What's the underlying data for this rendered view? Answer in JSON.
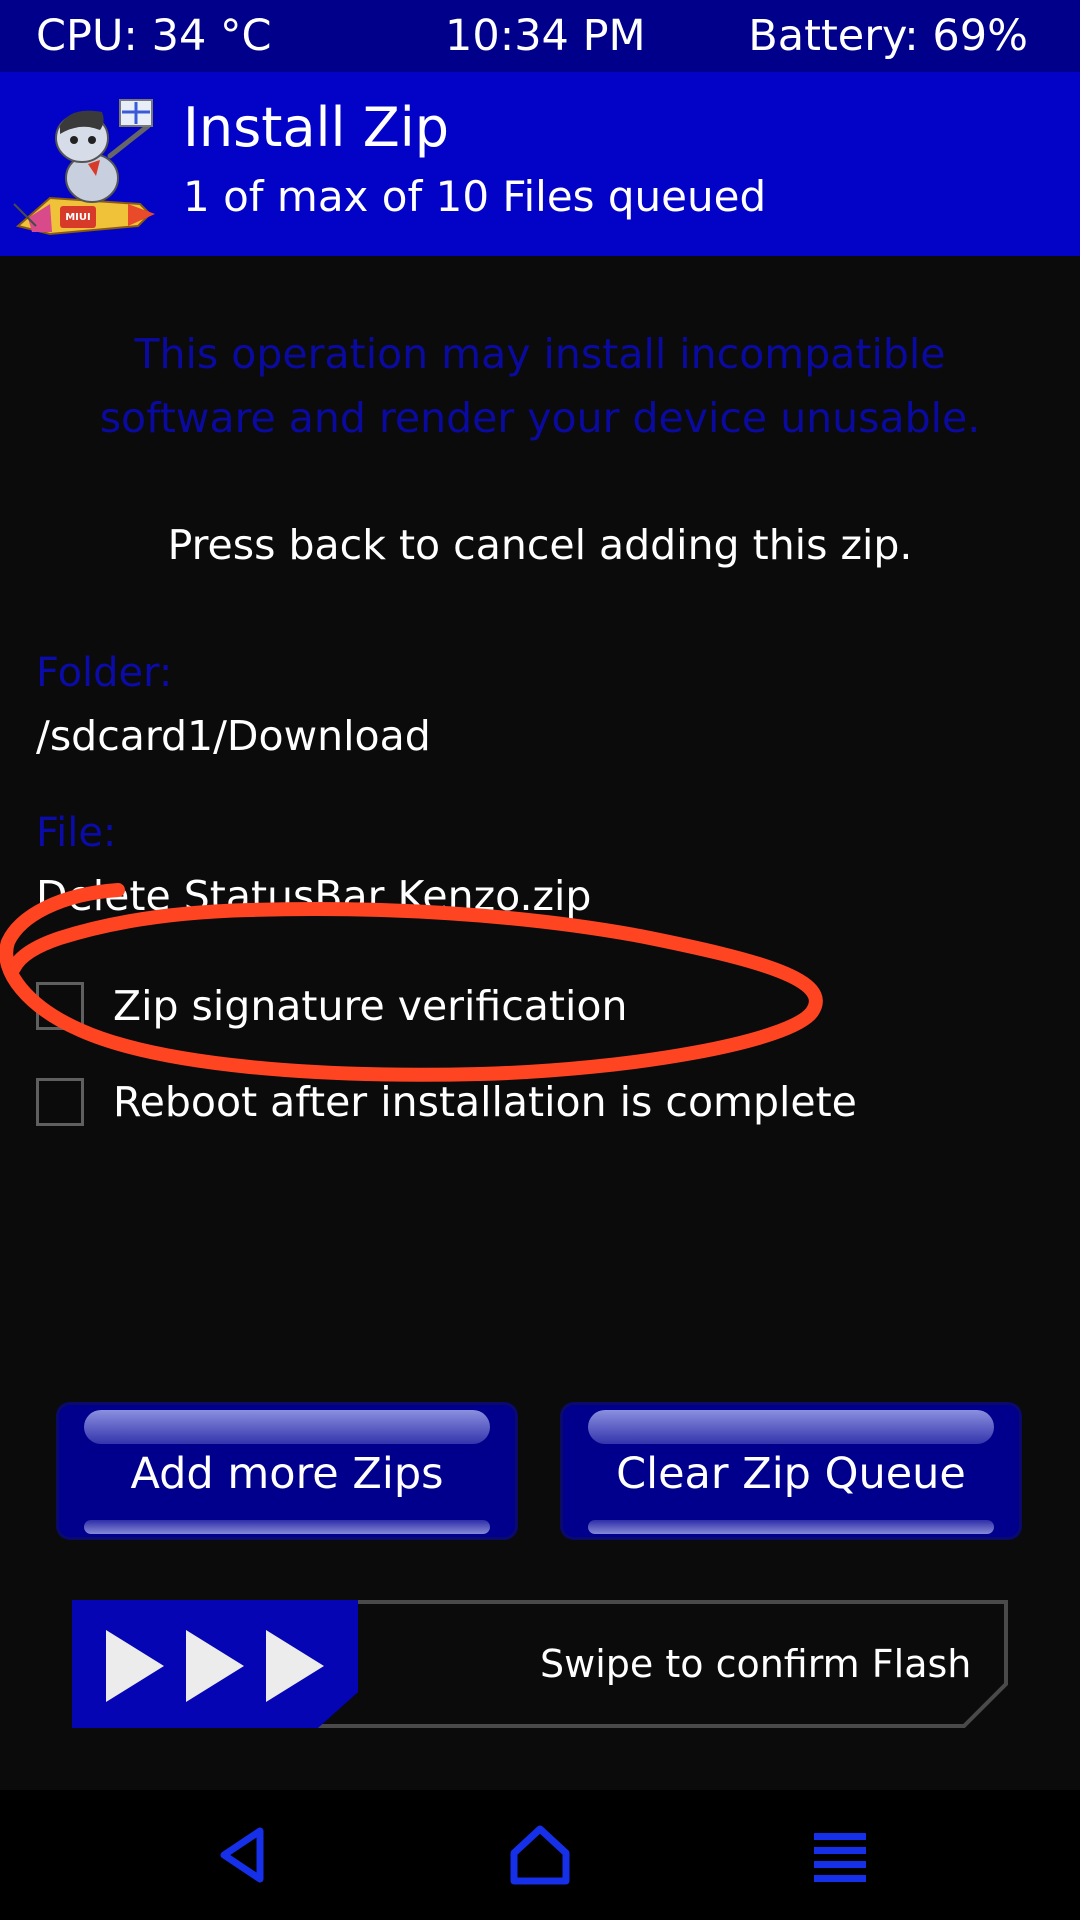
{
  "status_bar": {
    "cpu": "CPU: 34 °C",
    "time": "10:34 PM",
    "battery": "Battery: 69%"
  },
  "header": {
    "logo": "miui-rocket-logo",
    "title": "Install Zip",
    "subtitle": "1 of max of 10 Files queued"
  },
  "warning": {
    "line1": "This operation may install incompatible",
    "line2": "software and render your device unusable."
  },
  "cancel_hint": "Press back to cancel adding this zip.",
  "folder": {
    "label": "Folder:",
    "value": "/sdcard1/Download"
  },
  "file": {
    "label": "File:",
    "value": "Delete StatusBar Kenzo.zip"
  },
  "options": [
    {
      "label": "Zip signature verification",
      "checked": false
    },
    {
      "label": "Reboot after installation is complete",
      "checked": false
    }
  ],
  "buttons": {
    "add_more": "Add more Zips",
    "clear_queue": "Clear Zip Queue"
  },
  "swipe": {
    "label": "Swipe to confirm Flash",
    "icon": "triple-play-arrows-icon"
  },
  "nav": {
    "back_icon": "back-triangle-icon",
    "home_icon": "home-icon",
    "menu_icon": "menu-lines-icon"
  },
  "colors": {
    "header_bg": "#0303c8",
    "status_bg": "#00008b",
    "accent_blue": "#0505b4",
    "annotation_red": "#ff4422",
    "background": "#0b0b0b"
  }
}
